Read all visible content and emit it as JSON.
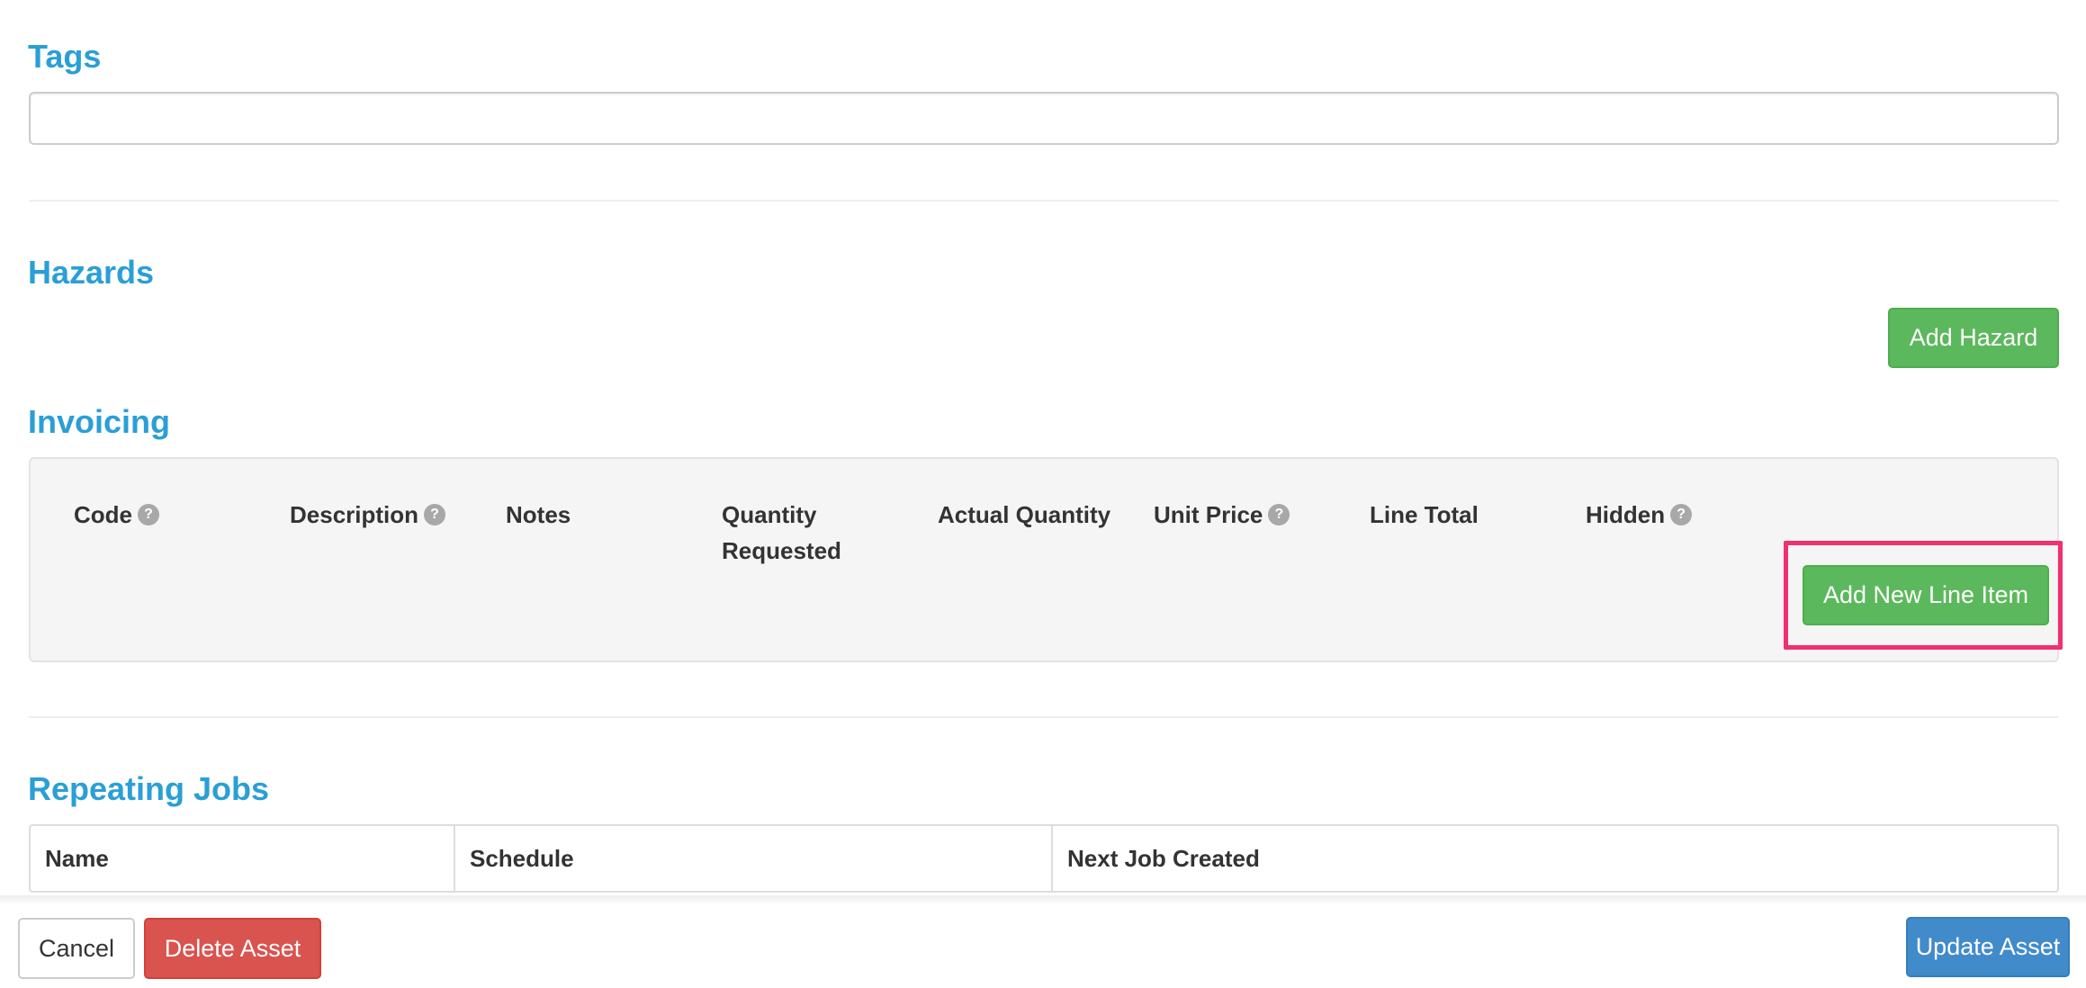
{
  "tags": {
    "title": "Tags",
    "input_value": "",
    "input_placeholder": ""
  },
  "hazards": {
    "title": "Hazards",
    "add_button": "Add Hazard"
  },
  "invoicing": {
    "title": "Invoicing",
    "columns": [
      {
        "label": "Code",
        "help": true
      },
      {
        "label": "Description",
        "help": true
      },
      {
        "label": "Notes",
        "help": false
      },
      {
        "label": "Quantity Requested",
        "help": false
      },
      {
        "label": "Actual Quantity",
        "help": false
      },
      {
        "label": "Unit Price",
        "help": true
      },
      {
        "label": "Line Total",
        "help": false
      },
      {
        "label": "Hidden",
        "help": true
      }
    ],
    "help_glyph": "?",
    "add_line_item_button": "Add New Line Item"
  },
  "repeating_jobs": {
    "title": "Repeating Jobs",
    "columns": [
      "Name",
      "Schedule",
      "Next Job Created"
    ]
  },
  "footer": {
    "cancel": "Cancel",
    "delete": "Delete Asset",
    "update": "Update Asset"
  },
  "colors": {
    "heading": "#2a9fd6",
    "success": "#5cb85c",
    "danger": "#d9534f",
    "primary": "#428bca",
    "highlight": "#f0306f"
  },
  "icons": {
    "help": "question-circle-icon"
  }
}
